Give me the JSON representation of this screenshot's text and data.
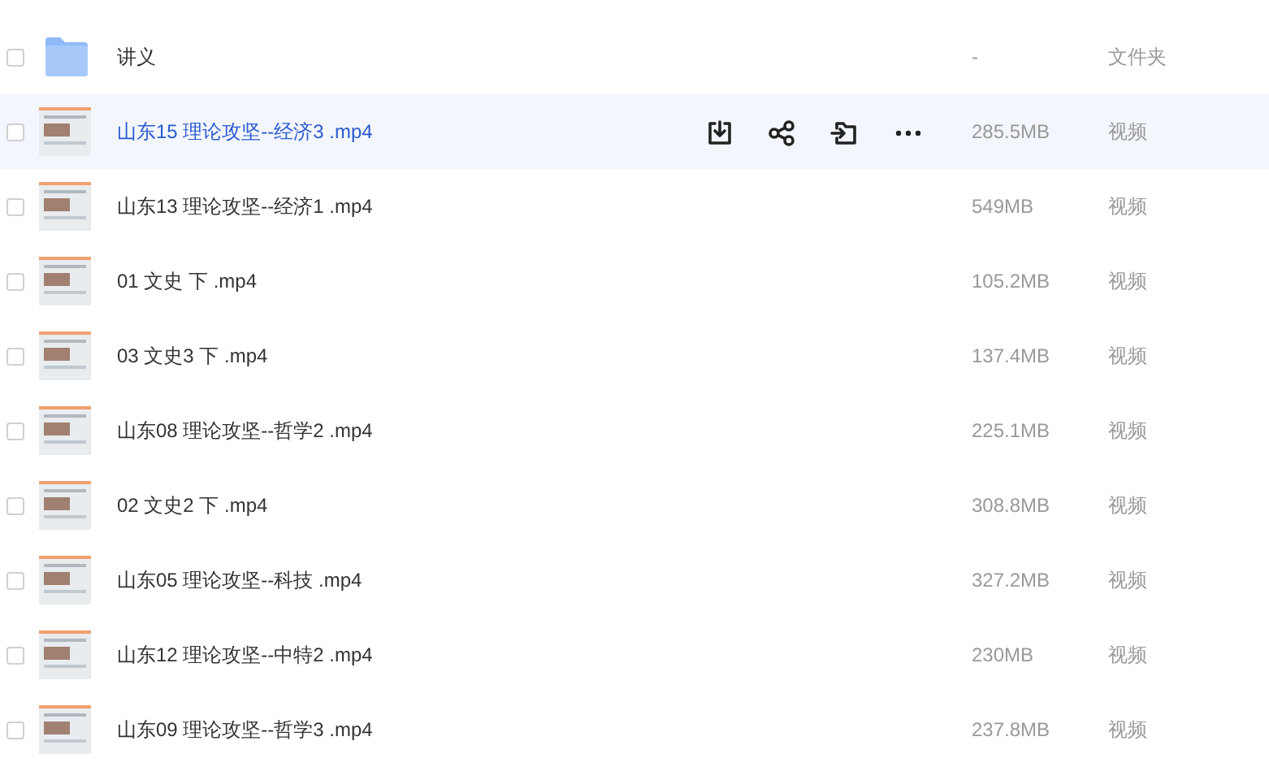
{
  "files": [
    {
      "kind": "folder",
      "name": "讲义",
      "size": "-",
      "type": "文件夹",
      "hovered": false
    },
    {
      "kind": "video",
      "name": "山东15 理论攻坚--经济3 .mp4",
      "size": "285.5MB",
      "type": "视频",
      "hovered": true
    },
    {
      "kind": "video",
      "name": "山东13 理论攻坚--经济1 .mp4",
      "size": "549MB",
      "type": "视频",
      "hovered": false
    },
    {
      "kind": "video",
      "name": "01 文史 下 .mp4",
      "size": "105.2MB",
      "type": "视频",
      "hovered": false
    },
    {
      "kind": "video",
      "name": "03 文史3 下 .mp4",
      "size": "137.4MB",
      "type": "视频",
      "hovered": false
    },
    {
      "kind": "video",
      "name": "山东08 理论攻坚--哲学2 .mp4",
      "size": "225.1MB",
      "type": "视频",
      "hovered": false
    },
    {
      "kind": "video",
      "name": "02 文史2 下 .mp4",
      "size": "308.8MB",
      "type": "视频",
      "hovered": false
    },
    {
      "kind": "video",
      "name": "山东05 理论攻坚--科技 .mp4",
      "size": "327.2MB",
      "type": "视频",
      "hovered": false
    },
    {
      "kind": "video",
      "name": "山东12 理论攻坚--中特2 .mp4",
      "size": "230MB",
      "type": "视频",
      "hovered": false
    },
    {
      "kind": "video",
      "name": "山东09 理论攻坚--哲学3 .mp4",
      "size": "237.8MB",
      "type": "视频",
      "hovered": false
    }
  ]
}
